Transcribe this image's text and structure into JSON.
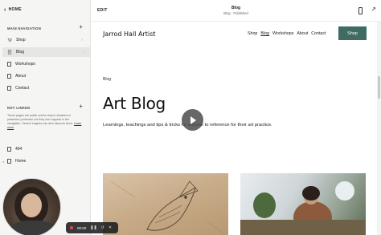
{
  "sidebar": {
    "home_label": "HOME",
    "main_nav_heading": "MAIN NAVIGATION",
    "main_items": [
      {
        "label": "Shop",
        "icon": "cart-icon"
      },
      {
        "label": "Blog",
        "icon": "page-icon"
      },
      {
        "label": "Workshops",
        "icon": "page-icon"
      },
      {
        "label": "About",
        "icon": "page-icon"
      },
      {
        "label": "Contact",
        "icon": "page-icon"
      }
    ],
    "not_linked_heading": "NOT LINKED",
    "not_linked_note": "These pages are public unless they're disabled or password-protected, but they don't appear in the navigation. Search engines can also discover them.",
    "learn_more": "Learn more",
    "not_linked_items": [
      {
        "label": "404"
      },
      {
        "label": "Home"
      }
    ]
  },
  "topbar": {
    "edit_label": "EDIT",
    "page_title": "Blog",
    "page_status": "Blog · Published"
  },
  "site": {
    "title": "Jarrod Hall Artist",
    "nav": [
      "Shop",
      "Blog",
      "Workshops",
      "About",
      "Contact"
    ],
    "active_nav": "Blog",
    "shop_button": "Shop",
    "breadcrumb": "Blog",
    "heading": "Art Blog",
    "description": "Learnings, teachings and tips & tricks for anyone to reference for their art practice."
  },
  "recorder": {
    "timer": "00:00"
  },
  "colors": {
    "accent": "#3f6b61",
    "sidebar_bg": "#f5f5f3"
  }
}
